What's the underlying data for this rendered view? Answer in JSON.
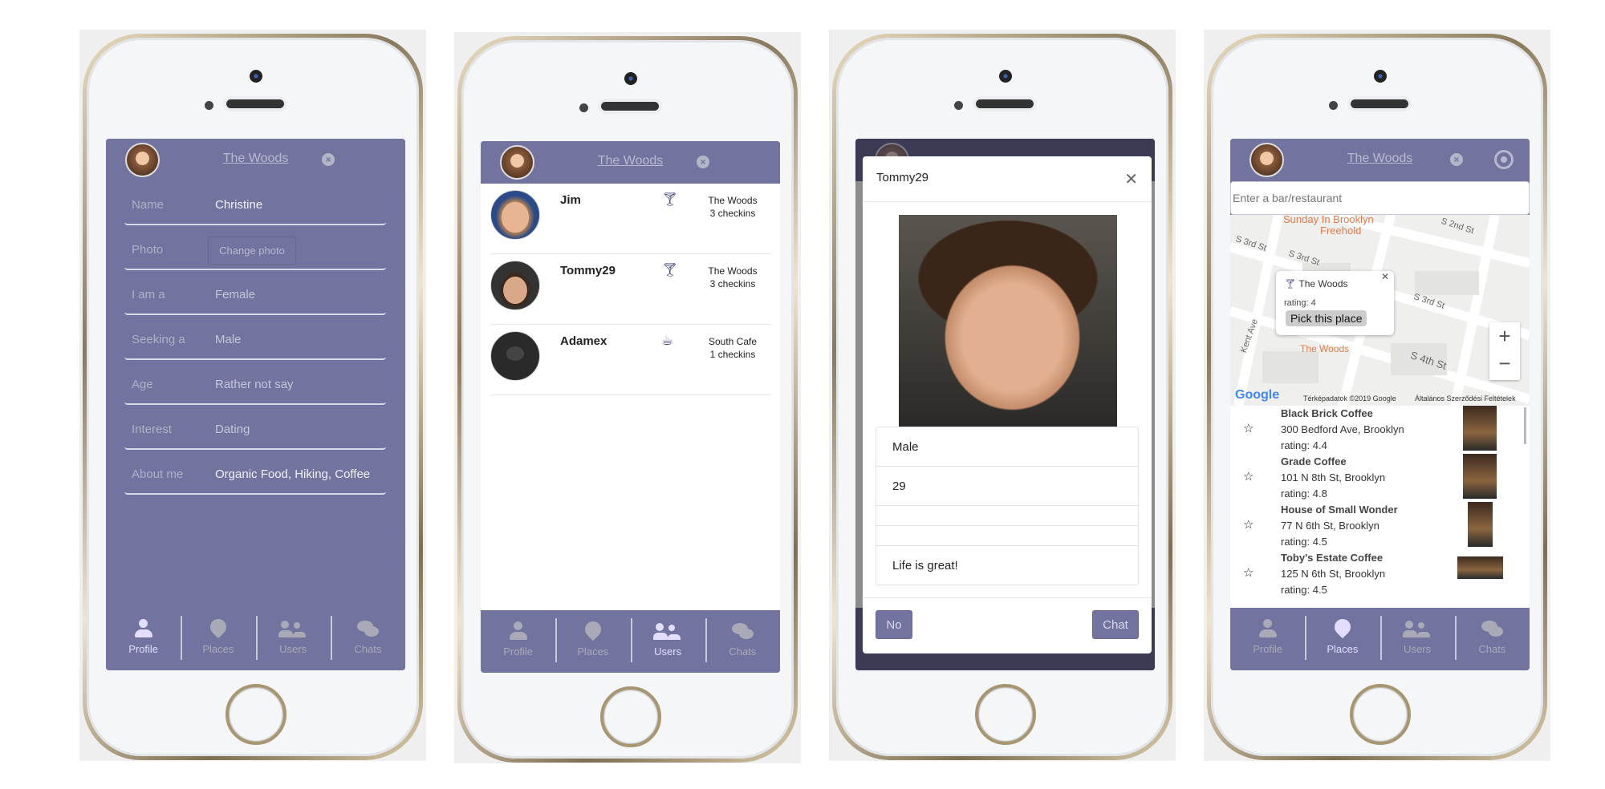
{
  "header": {
    "venue": "The Woods",
    "close_icon": "times-circle-icon",
    "locate_icon": "crosshairs-icon"
  },
  "nav": [
    "Profile",
    "Places",
    "Users",
    "Chats"
  ],
  "profile": {
    "fields": [
      {
        "label": "Name",
        "value": "Christine"
      },
      {
        "label": "Photo",
        "value": "Change photo"
      },
      {
        "label": "I am a",
        "value": "Female"
      },
      {
        "label": "Seeking a",
        "value": "Male"
      },
      {
        "label": "Age",
        "value": "Rather not say"
      },
      {
        "label": "Interest",
        "value": "Dating"
      },
      {
        "label": "About me",
        "value": "Organic Food, Hiking, Coffee"
      }
    ]
  },
  "users": [
    {
      "name": "Jim",
      "icon": "cocktail-icon",
      "place": "The Woods",
      "checkins": "3 checkins"
    },
    {
      "name": "Tommy29",
      "icon": "cocktail-icon",
      "place": "The Woods",
      "checkins": "3 checkins"
    },
    {
      "name": "Adamex",
      "icon": "coffee-icon",
      "place": "South Cafe",
      "checkins": "1 checkins"
    }
  ],
  "modal": {
    "title": "Tommy29",
    "rows": [
      "Male",
      "29",
      "",
      "",
      "Life is great!"
    ],
    "no": "No",
    "chat": "Chat"
  },
  "places": {
    "search_placeholder": "Enter a bar/restaurant",
    "map": {
      "labels": [
        "Sunday In Brooklyn",
        "Freehold",
        "S 2nd St",
        "S 3rd St",
        "S 3rd St",
        "S 3rd St",
        "Kent Ave",
        "S 4th St",
        "The Woods",
        "Google",
        "Térképadatok ©2019 Google",
        "Általános Szerződési Feltételek"
      ],
      "popup": {
        "name": "The Woods",
        "rating": "rating: 4",
        "button": "Pick this place"
      }
    },
    "list": [
      {
        "name": "Black Brick Coffee",
        "address": "300 Bedford Ave, Brooklyn",
        "rating": "rating: 4.4"
      },
      {
        "name": "Grade Coffee",
        "address": "101 N 8th St, Brooklyn",
        "rating": "rating: 4.8"
      },
      {
        "name": "House of Small Wonder",
        "address": "77 N 6th St, Brooklyn",
        "rating": "rating: 4.5"
      },
      {
        "name": "Toby's Estate Coffee",
        "address": "125 N 6th St, Brooklyn",
        "rating": "rating: 4.5"
      }
    ]
  },
  "colors": {
    "primary": "#7373a0",
    "active_nav": "#e3deff",
    "inactive_nav": "#a9a9b8"
  }
}
